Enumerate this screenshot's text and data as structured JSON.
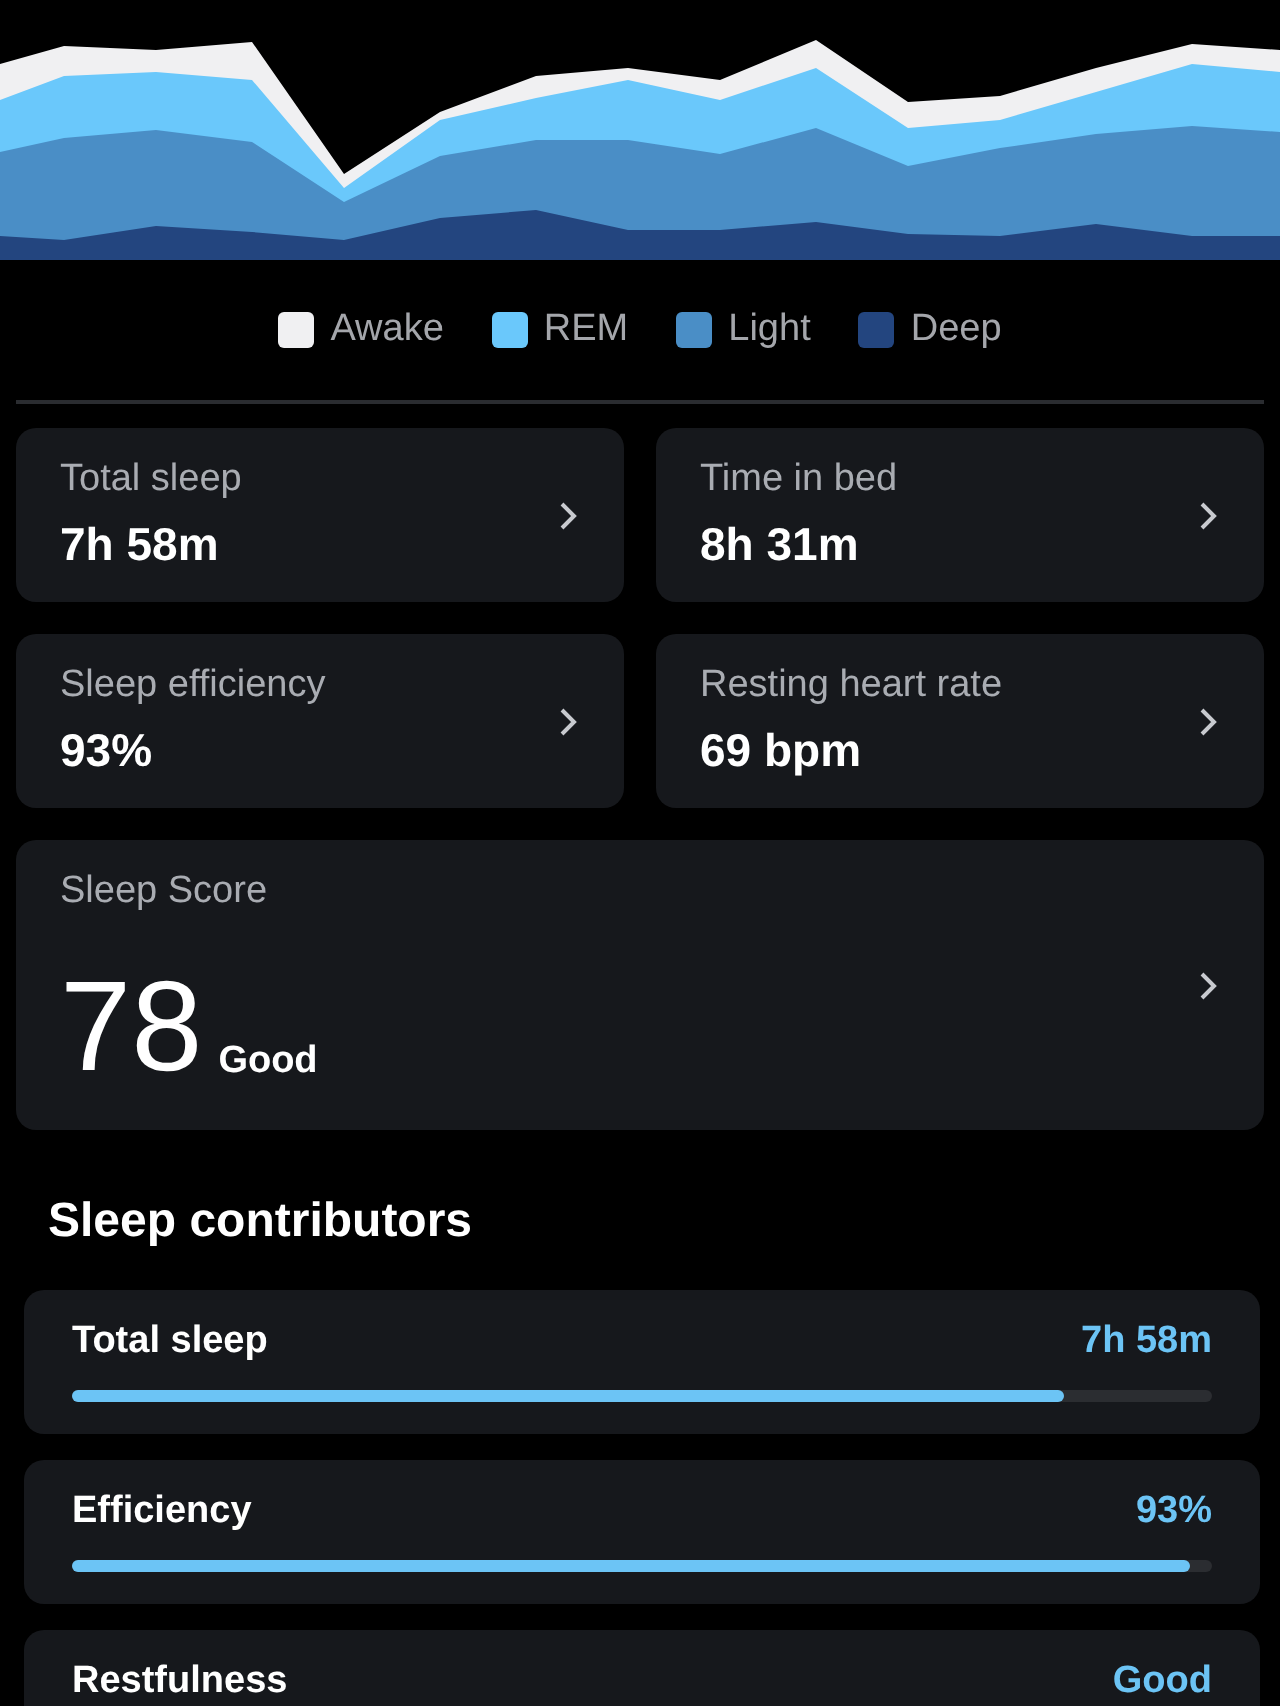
{
  "sleep_stages_chart": {
    "legend": [
      {
        "label": "Awake",
        "color": "#f0f0f2"
      },
      {
        "label": "REM",
        "color": "#6ac8fb"
      },
      {
        "label": "Light",
        "color": "#4a8ec6"
      },
      {
        "label": "Deep",
        "color": "#23457f"
      }
    ]
  },
  "metrics": [
    {
      "label": "Total sleep",
      "value": "7h 58m"
    },
    {
      "label": "Time in bed",
      "value": "8h 31m"
    },
    {
      "label": "Sleep efficiency",
      "value": "93%"
    },
    {
      "label": "Resting heart rate",
      "value": "69 bpm"
    }
  ],
  "sleep_score": {
    "label": "Sleep Score",
    "value": "78",
    "rating": "Good"
  },
  "contributors": {
    "title": "Sleep contributors",
    "items": [
      {
        "label": "Total sleep",
        "value": "7h 58m",
        "level": 0.87
      },
      {
        "label": "Efficiency",
        "value": "93%",
        "level": 0.98
      },
      {
        "label": "Restfulness",
        "value": "Good"
      }
    ]
  }
}
